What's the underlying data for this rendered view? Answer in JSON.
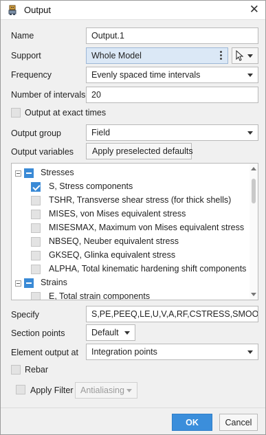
{
  "window": {
    "title": "Output",
    "title_icon": "robot-icon",
    "close_icon": "close-icon"
  },
  "form": {
    "name_label": "Name",
    "name_value": "Output.1",
    "support_label": "Support",
    "support_value": "Whole Model",
    "frequency_label": "Frequency",
    "frequency_value": "Evenly spaced time intervals",
    "intervals_label": "Number of intervals",
    "intervals_value": "20",
    "exact_times_label": "Output at exact times",
    "output_group_label": "Output group",
    "output_group_value": "Field",
    "output_variables_label": "Output variables",
    "apply_defaults_label": "Apply preselected defaults"
  },
  "tree": {
    "items": [
      {
        "label": "Stresses",
        "level": 0,
        "state": "mixed"
      },
      {
        "label": "S, Stress components",
        "level": 1,
        "state": "checked"
      },
      {
        "label": "TSHR, Transverse shear stress (for thick shells)",
        "level": 1,
        "state": "unchecked"
      },
      {
        "label": "MISES, von Mises equivalent stress",
        "level": 1,
        "state": "unchecked"
      },
      {
        "label": "MISESMAX, Maximum von Mises equivalent stress",
        "level": 1,
        "state": "unchecked"
      },
      {
        "label": "NBSEQ, Neuber equivalent stress",
        "level": 1,
        "state": "unchecked"
      },
      {
        "label": "GKSEQ, Glinka equivalent stress",
        "level": 1,
        "state": "unchecked"
      },
      {
        "label": "ALPHA, Total kinematic hardening shift components",
        "level": 1,
        "state": "unchecked"
      },
      {
        "label": "Strains",
        "level": 0,
        "state": "mixed"
      },
      {
        "label": "E, Total strain components",
        "level": 1,
        "state": "unchecked"
      }
    ]
  },
  "lower": {
    "specify_label": "Specify",
    "specify_value": "S,PE,PEEQ,LE,U,V,A,RF,CSTRESS,SMOOTHLEN,",
    "section_points_label": "Section points",
    "section_points_value": "Default",
    "element_output_label": "Element output at",
    "element_output_value": "Integration points",
    "rebar_label": "Rebar",
    "apply_filter_label": "Apply Filter",
    "filter_value": "Antialiasing"
  },
  "buttons": {
    "ok": "OK",
    "cancel": "Cancel"
  },
  "colors": {
    "accent": "#3b8edb",
    "selected_field": "#dbe8f6"
  }
}
